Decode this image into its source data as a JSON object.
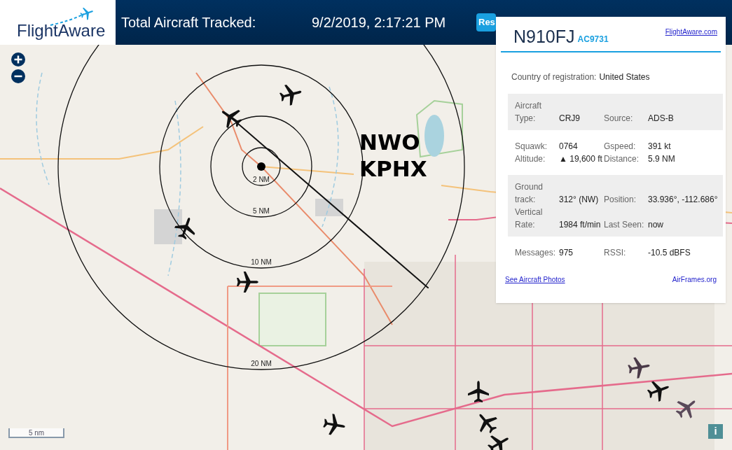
{
  "header": {
    "logo_text": "FlightAware",
    "title": "Total Aircraft Tracked:",
    "timestamp": "9/2/2019, 2:17:21 PM",
    "button": "Res"
  },
  "map": {
    "range_rings": [
      "2 NM",
      "5 NM",
      "10 NM",
      "20 NM"
    ],
    "site_labels": [
      "NWO",
      "KPHX"
    ],
    "scale": "5 nm",
    "info_button": "i"
  },
  "panel": {
    "registration": "N910FJ",
    "hex": "AC9731",
    "link": "FlightAware.com",
    "country_label": "Country of registration:",
    "country": "United States",
    "groups": [
      {
        "rows": [
          {
            "label": "Aircraft Type:",
            "value": "CRJ9",
            "label2": "Source:",
            "value2": "ADS-B"
          }
        ]
      },
      {
        "rows": [
          {
            "label": "Squawk:",
            "value": "0764",
            "label2": "Gspeed:",
            "value2": "391 kt"
          },
          {
            "label": "Altitude:",
            "value": "▲ 19,600 ft",
            "label2": "Distance:",
            "value2": "5.9 NM"
          }
        ]
      },
      {
        "rows": [
          {
            "label": "Ground track:",
            "value": "312° (NW)",
            "label2": "Position:",
            "value2": "33.936°, -112.686°"
          },
          {
            "label": "Vertical Rate:",
            "value": "1984 ft/min",
            "label2": "Last Seen:",
            "value2": "now"
          }
        ]
      },
      {
        "rows": [
          {
            "label": "Messages:",
            "value": "975",
            "label2": "RSSI:",
            "value2": "-10.5 dBFS"
          }
        ]
      }
    ],
    "photos_link": "See Aircraft Photos",
    "airframes_link": "AirFrames.org"
  }
}
